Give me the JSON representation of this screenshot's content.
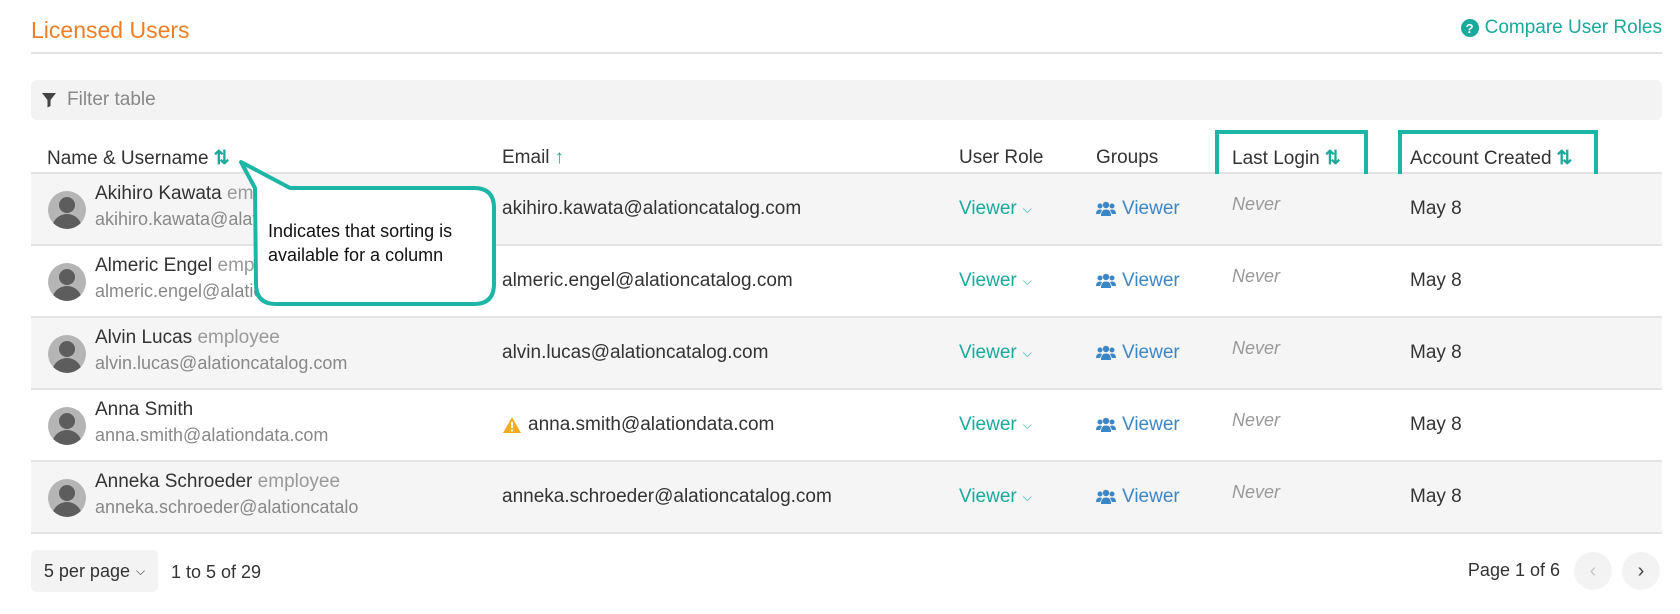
{
  "page": {
    "title": "Licensed Users",
    "compare_link": "Compare User Roles",
    "filter_placeholder": "Filter table"
  },
  "columns": {
    "name": "Name & Username",
    "email": "Email",
    "role": "User Role",
    "groups": "Groups",
    "last_login": "Last Login",
    "created": "Account Created"
  },
  "sort_icons": {
    "name": "sort-both-icon",
    "email": "sort-ascending-icon",
    "last_login": "sort-both-icon",
    "created": "sort-both-icon"
  },
  "rows": [
    {
      "name": "Akihiro Kawata",
      "tag": "employee",
      "login": "akihiro.kawata@alationcatalog.com",
      "email": "akihiro.kawata@alationcatalog.com",
      "warning": false,
      "role": "Viewer",
      "group": "Viewer",
      "last_login": "Never",
      "created": "May 8"
    },
    {
      "name": "Almeric Engel",
      "tag": "employee",
      "login": "almeric.engel@alationcatalog.com",
      "email": "almeric.engel@alationcatalog.com",
      "warning": false,
      "role": "Viewer",
      "group": "Viewer",
      "last_login": "Never",
      "created": "May 8"
    },
    {
      "name": "Alvin Lucas",
      "tag": "employee",
      "login": "alvin.lucas@alationcatalog.com",
      "email": "alvin.lucas@alationcatalog.com",
      "warning": false,
      "role": "Viewer",
      "group": "Viewer",
      "last_login": "Never",
      "created": "May 8"
    },
    {
      "name": "Anna Smith",
      "tag": "",
      "login": "anna.smith@alationdata.com",
      "email": "anna.smith@alationdata.com",
      "warning": true,
      "role": "Viewer",
      "group": "Viewer",
      "last_login": "Never",
      "created": "May 8"
    },
    {
      "name": "Anneka Schroeder",
      "tag": "employee",
      "login": "anneka.schroeder@alationcatalo",
      "email": "anneka.schroeder@alationcatalog.com",
      "warning": false,
      "role": "Viewer",
      "group": "Viewer",
      "last_login": "Never",
      "created": "May 8"
    }
  ],
  "footer": {
    "per_page": "5 per page",
    "range": "1 to 5 of 29",
    "page_info": "Page 1 of 6"
  },
  "annotation": {
    "text": "Indicates that sorting is available for a column"
  },
  "colors": {
    "title": "#ef7f27",
    "accent": "#1aa99a",
    "highlight": "#1db5a5",
    "group_link": "#3d86c6",
    "warning": "#f0ad1f"
  }
}
